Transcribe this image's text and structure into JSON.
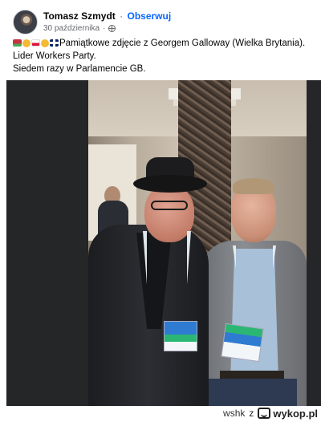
{
  "post": {
    "author": "Tomasz Szmydt",
    "separator": "·",
    "follow_label": "Obserwuj",
    "date": "30 października",
    "audience_icon": "globe-icon",
    "lines": [
      "Pamiątkowe zdjęcie z Georgem Galloway (Wielka Brytania).",
      "Lider Workers Party.",
      "Siedem razy w Parlamencie GB."
    ],
    "flags": [
      "flag-belarus",
      "hand-emoji",
      "flag-poland",
      "hand-emoji",
      "flag-united-kingdom"
    ]
  },
  "watermark": {
    "author": "wshk",
    "connector": "z",
    "site": "wykop.pl"
  },
  "colors": {
    "link": "#0866ff",
    "text": "#050505",
    "meta": "#65676b",
    "photo_border": "#242628"
  }
}
